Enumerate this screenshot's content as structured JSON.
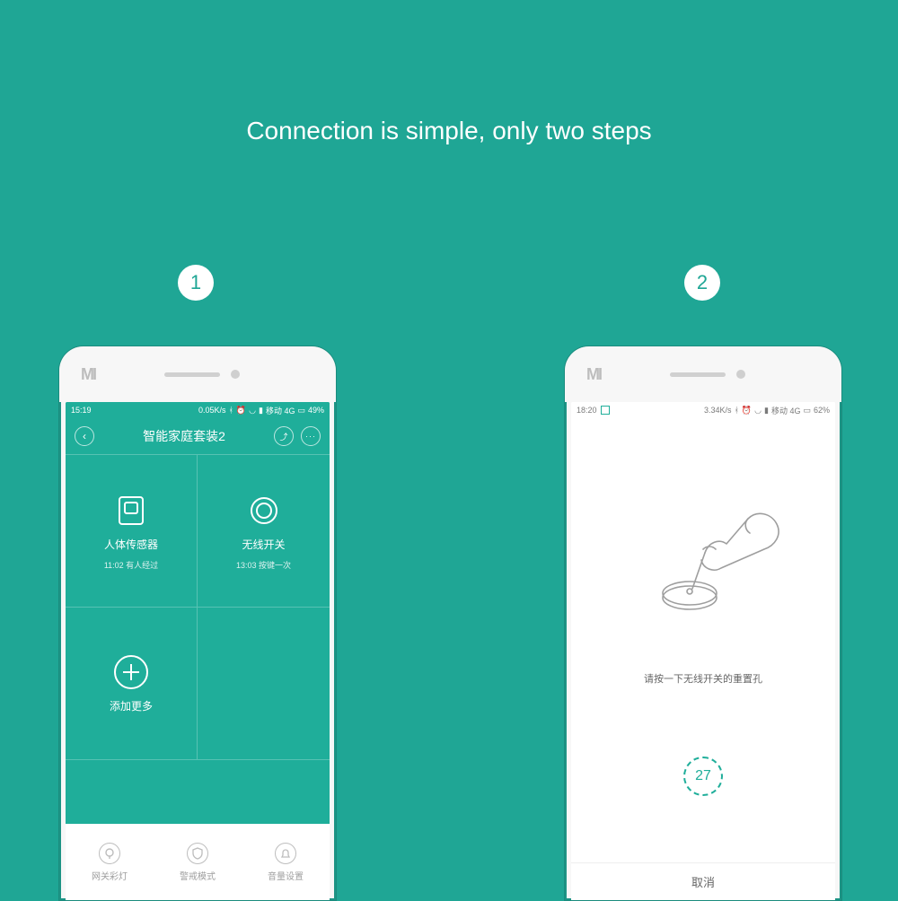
{
  "headline": "Connection is simple, only two steps",
  "steps": {
    "one": "1",
    "two": "2"
  },
  "brand": "MI",
  "phone1": {
    "status": {
      "time": "15:19",
      "speed": "0.05K/s",
      "net": "移动 4G",
      "battery": "49%"
    },
    "title": "智能家庭套装2",
    "cells": [
      {
        "label": "人体传感器",
        "sub": "11:02 有人经过"
      },
      {
        "label": "无线开关",
        "sub": "13:03 按键一次"
      },
      {
        "label": "添加更多",
        "sub": ""
      }
    ],
    "bottom": [
      "网关彩灯",
      "警戒模式",
      "音量设置"
    ]
  },
  "phone2": {
    "status": {
      "time": "18:20",
      "speed": "3.34K/s",
      "net": "移动 4G",
      "battery": "62%"
    },
    "instruction": "请按一下无线开关的重置孔",
    "countdown": "27",
    "cancel": "取消"
  }
}
